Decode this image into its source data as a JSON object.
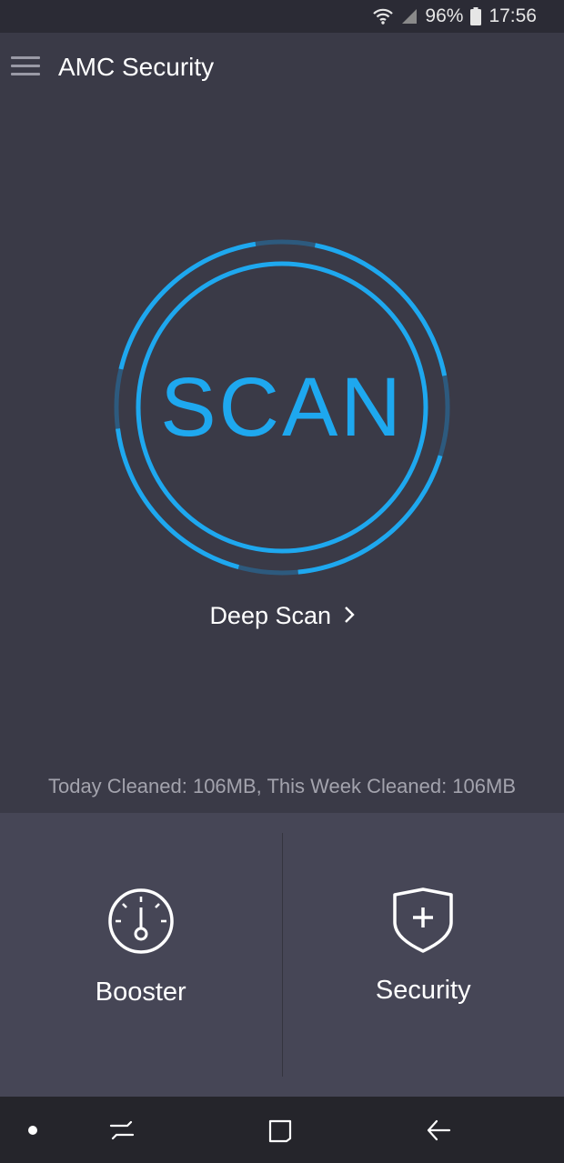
{
  "status_bar": {
    "battery": "96%",
    "time": "17:56"
  },
  "app_bar": {
    "title": "AMC Security"
  },
  "scan": {
    "label": "SCAN",
    "deep_scan_label": "Deep Scan",
    "ring_color": "#1ea8ef"
  },
  "stats": {
    "text": "Today Cleaned: 106MB, This Week Cleaned: 106MB"
  },
  "tools": [
    {
      "label": "Booster",
      "icon": "speedometer-icon"
    },
    {
      "label": "Security",
      "icon": "shield-plus-icon"
    }
  ],
  "nav": {
    "items": [
      "dot-icon",
      "recent-apps-icon",
      "home-icon",
      "back-icon"
    ]
  }
}
